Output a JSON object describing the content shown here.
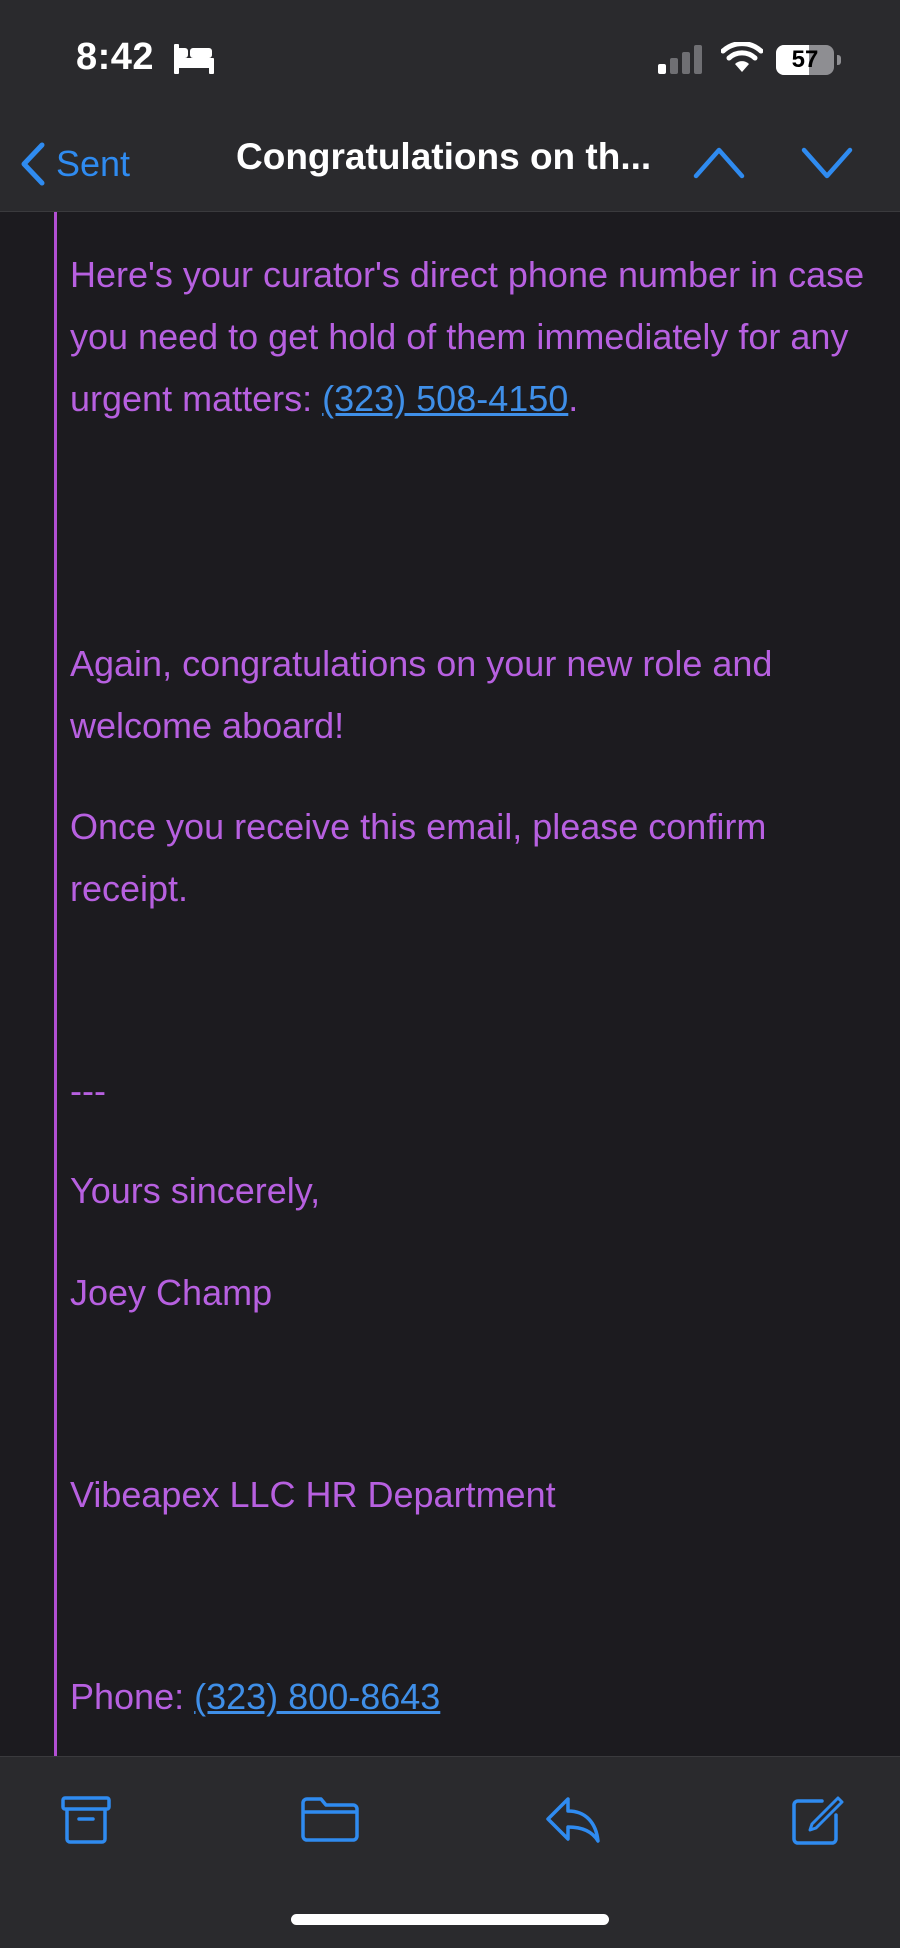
{
  "status_bar": {
    "time": "8:42",
    "battery": "57",
    "battery_level": 0.57,
    "icons": [
      "bed-icon",
      "cellular-signal-icon",
      "wifi-icon",
      "battery-icon"
    ]
  },
  "nav": {
    "back_label": "Sent",
    "title": "Congratulations on th...",
    "icons": [
      "chevron-left-icon",
      "chevron-up-icon",
      "chevron-down-icon"
    ]
  },
  "email": {
    "p1_text": "Here's your curator's direct phone number in case you need to get hold of them immediately for any urgent matters: ",
    "p1_link": "(323) 508-4150",
    "p1_end": ".",
    "p2": "Again, congratulations on your new role and welcome aboard!",
    "p3": "Once you receive this email, please confirm receipt.",
    "separator": "---",
    "closing": "Yours sincerely,",
    "sender_name": "Joey Champ",
    "department": "Vibeapex LLC HR Department",
    "phone_label": "Phone: ",
    "phone_link": "(323) 800-8643"
  },
  "colors": {
    "accent": "#2f8bf0",
    "email_text": "#b760e0",
    "quote_bar": "#b24fd3",
    "link": "#3f8fe8",
    "background": "#1c1b1f"
  },
  "toolbar": {
    "icons": [
      "archive-icon",
      "folder-icon",
      "reply-icon",
      "compose-icon"
    ]
  }
}
